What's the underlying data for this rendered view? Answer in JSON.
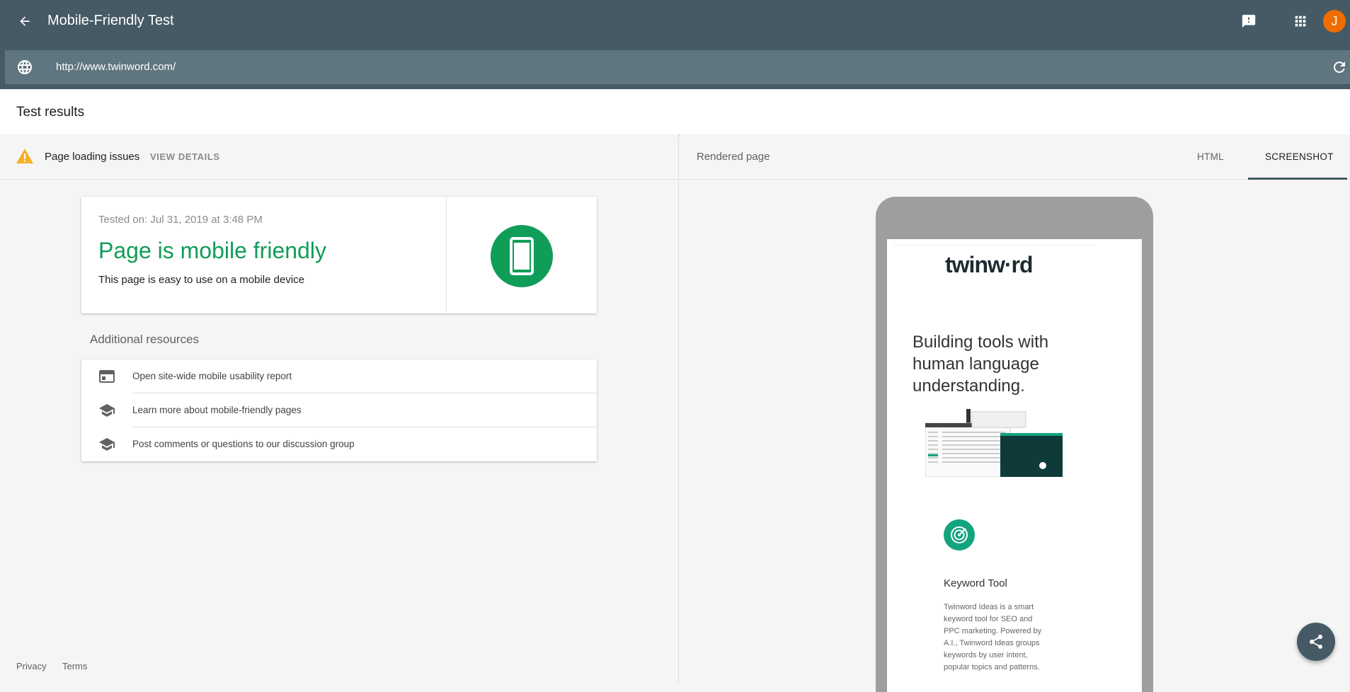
{
  "appbar": {
    "title": "Mobile-Friendly Test",
    "avatar_initial": "J"
  },
  "urlbar": {
    "value": "http://www.twinword.com/"
  },
  "header": {
    "title": "Test results"
  },
  "issues": {
    "label": "Page loading issues",
    "action": "VIEW DETAILS"
  },
  "result": {
    "tested_on": "Tested on: Jul 31, 2019 at 3:48 PM",
    "headline": "Page is mobile friendly",
    "subtitle": "This page is easy to use on a mobile device",
    "accent_color": "#0f9d58"
  },
  "resources": {
    "title": "Additional resources",
    "items": [
      {
        "label": "Open site-wide mobile usability report",
        "icon": "report-icon"
      },
      {
        "label": "Learn more about mobile-friendly pages",
        "icon": "school-icon"
      },
      {
        "label": "Post comments or questions to our discussion group",
        "icon": "school-icon"
      }
    ]
  },
  "footer": {
    "privacy": "Privacy",
    "terms": "Terms"
  },
  "rendered": {
    "label": "Rendered page",
    "tabs": [
      {
        "label": "HTML",
        "active": false
      },
      {
        "label": "SCREENSHOT",
        "active": true
      }
    ]
  },
  "preview": {
    "logo": "twinw·rd",
    "hero": "Building tools with human language understanding.",
    "feature_title": "Keyword Tool",
    "feature_desc": "Twinword Ideas is a smart keyword tool for SEO and PPC marketing. Powered by A.I., Twinword Ideas groups keywords by user intent, popular topics and patterns."
  },
  "colors": {
    "appbar": "#455a64",
    "urlbar": "#5f7580",
    "success": "#0f9d58",
    "warning": "#f6b026",
    "avatar": "#ef6c00"
  }
}
